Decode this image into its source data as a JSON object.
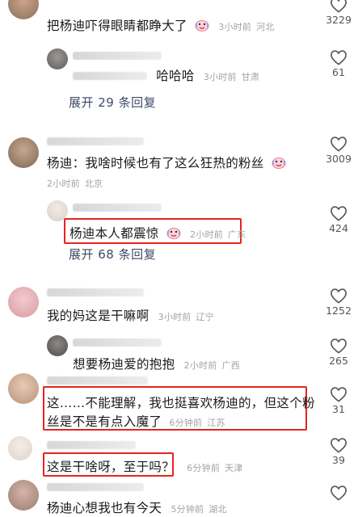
{
  "comments": [
    {
      "text": "把杨迪吓得眼睛都睁大了",
      "time": "3小时前",
      "location": "河北",
      "likes": "3229"
    },
    {
      "text": "哈哈哈",
      "time": "3小时前",
      "location": "甘肃",
      "likes": "61"
    },
    {
      "expand": "展开 29 条回复"
    },
    {
      "text": "杨迪：我啥时候也有了这么狂热的粉丝",
      "time": "2小时前",
      "location": "北京",
      "likes": "3009"
    },
    {
      "text": "杨迪本人都震惊",
      "time": "2小时前",
      "location": "广东",
      "likes": "424"
    },
    {
      "expand": "展开 68 条回复"
    },
    {
      "text": "我的妈这是干嘛啊",
      "time": "3小时前",
      "location": "辽宁",
      "likes": "1252"
    },
    {
      "text": "想要杨迪爱的抱抱",
      "time": "2小时前",
      "location": "广西",
      "likes": "265"
    },
    {
      "text_line1": "这……不能理解，我也挺喜欢杨迪的，但这个粉",
      "text_line2": "丝是不是有点入魔了",
      "time": "6分钟前",
      "location": "江苏",
      "likes": "31"
    },
    {
      "text": "这是干啥呀，至于吗？",
      "time": "6分钟前",
      "location": "天津",
      "likes": "39"
    },
    {
      "text": "杨迪心想我也有今天",
      "time": "5分钟前",
      "location": "湖北"
    }
  ],
  "colors": {
    "highlight_box": "#e8231f",
    "meta_text": "#a3a3a3",
    "expand_text": "#3d4a66"
  },
  "icons": [
    "heart-outline-icon",
    "crying-laughing-emoji-icon"
  ]
}
